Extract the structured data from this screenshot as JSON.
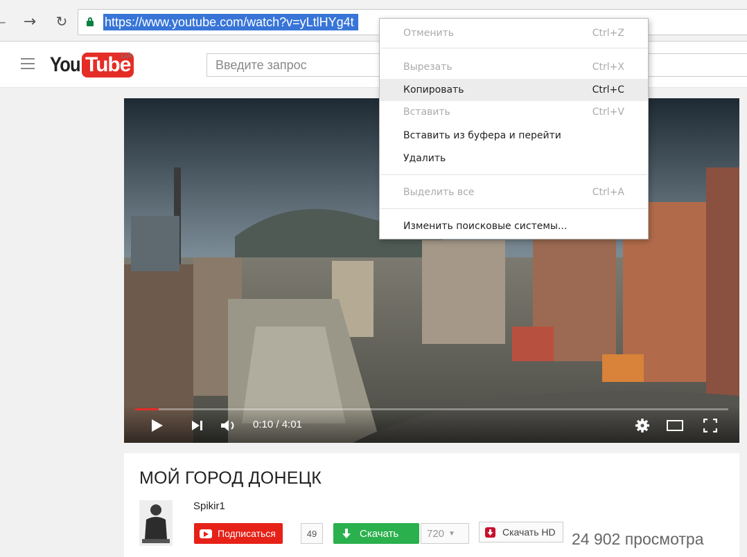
{
  "browser": {
    "url": "https://www.youtube.com/watch?v=yLtlHYg4t"
  },
  "header": {
    "logo_you": "You",
    "logo_tube": "Tube",
    "region": "UA",
    "search_placeholder": "Введите запрос"
  },
  "context_menu": {
    "items": [
      {
        "label": "Отменить",
        "shortcut": "Ctrl+Z",
        "disabled": true
      },
      {
        "label": "Вырезать",
        "shortcut": "Ctrl+X",
        "disabled": true
      },
      {
        "label": "Копировать",
        "shortcut": "Ctrl+C",
        "disabled": false,
        "highlighted": true
      },
      {
        "label": "Вставить",
        "shortcut": "Ctrl+V",
        "disabled": true
      },
      {
        "label": "Вставить из буфера и перейти",
        "shortcut": "",
        "disabled": false
      },
      {
        "label": "Удалить",
        "shortcut": "",
        "disabled": false
      },
      {
        "label": "Выделить все",
        "shortcut": "Ctrl+A",
        "disabled": true
      },
      {
        "label": "Изменить поисковые системы...",
        "shortcut": "",
        "disabled": false
      }
    ]
  },
  "player": {
    "time": "0:10 / 4:01",
    "progress_fraction": 0.04
  },
  "video": {
    "title": "МОЙ ГОРОД ДОНЕЦК",
    "channel": "Spikir1",
    "subscribe_label": "Подписаться",
    "subscriber_count": "49",
    "download_label": "Скачать",
    "quality": "720",
    "download_hd_label": "Скачать HD",
    "views": "24 902 просмотра"
  },
  "colors": {
    "accent_red": "#e52d27",
    "selection_blue": "#3875d7",
    "download_green": "#2ab04c"
  }
}
